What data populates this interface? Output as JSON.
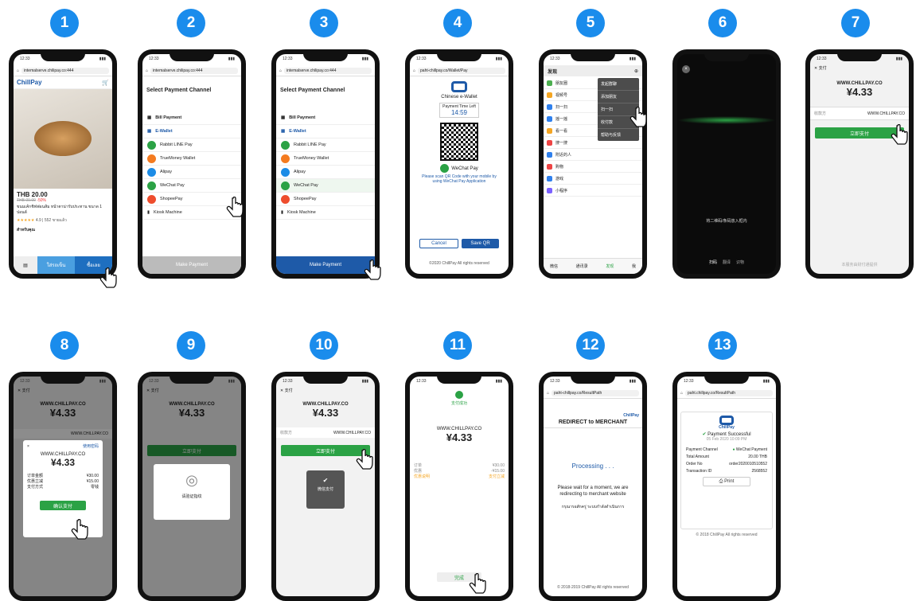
{
  "steps": [
    "1",
    "2",
    "3",
    "4",
    "5",
    "6",
    "7",
    "8",
    "9",
    "10",
    "11",
    "12",
    "13"
  ],
  "colors": {
    "step": "#1a8cec",
    "wechat_green": "#2ba245",
    "chillpay_blue": "#1e5aa8"
  },
  "s1": {
    "url": "intemalserve.chilipay.co:444",
    "logo": "ChillPay",
    "price": "THB 20.00",
    "old_price": "THB 00.00",
    "discount": "-50%",
    "desc": "ขนมเค้กชิฟฟอนส้ม หน้าตาน่ารับประทาน ขนาด 1 ปอนด์",
    "rating": "4.9 | 552 ขายแล้ว",
    "shop": "สำหรับคุณ",
    "cart": "ใส่รถเข็น",
    "buy": "ซื้อเลย"
  },
  "s2": {
    "url": "intemalserve.chilipay.co:444",
    "title": "Select Payment Channel",
    "bill": "Bill Payment",
    "ewallet": "E-Wallet",
    "items": [
      "Rabbit LINE Pay",
      "TrueMoney Wallet",
      "Alipay",
      "WeChat Pay",
      "ShopeePay"
    ],
    "kiosk": "Kiosk Machine",
    "make": "Make Payment"
  },
  "s4": {
    "url": "paht-chillpay.co/Wallet/Pay",
    "brand": "Chinese e-Wallet",
    "timer_label": "Payment Time Left",
    "timer": "14:59",
    "wechat": "WeChat Pay",
    "hint": "Please scan QR Code with your mobile by using WeChat Pay Application",
    "cancel": "Cancel",
    "save": "Save QR",
    "copy": "©2020 ChillPay All rights reserved"
  },
  "s5": {
    "title": "发现",
    "rows": [
      "朋友圈",
      "视频号",
      "扫一扫",
      "摇一摇",
      "看一看",
      "搜一搜",
      "附近的人",
      "购物",
      "游戏",
      "小程序"
    ],
    "menu": [
      "发起群聊",
      "添加朋友",
      "扫一扫",
      "收付款",
      "帮助与反馈"
    ],
    "tabs": [
      "微信",
      "通讯录",
      "发现",
      "我"
    ]
  },
  "s6": {
    "hint": "将二维码/条码放入框内",
    "tabs": [
      "扫码",
      "翻译",
      "识物"
    ]
  },
  "s7": {
    "back": "支付",
    "merchant": "WWW.CHILLPAY.CO",
    "amount": "¥4.33",
    "payee_label": "收款方",
    "payee": "WWW.CHILLPAY.CO",
    "pay": "立即支付",
    "foot": "本服务由财付通提供"
  },
  "s8": {
    "back": "支付",
    "merchant": "WWW.CHILLPAY.CO",
    "amount": "¥4.33",
    "payee": "WWW.CHILLPAY.CO",
    "close": "×",
    "change": "使用密码",
    "d_merchant": "WWW.CHILLPAY.CO",
    "d_amount": "¥4.33",
    "r1_l": "订单金额",
    "r1_v": "¥30.00",
    "r2_l": "优惠立减",
    "r2_v": "¥15.00",
    "r3_l": "支付方式",
    "r3_v": "零钱",
    "confirm": "确认支付"
  },
  "s9": {
    "back": "支付",
    "merchant": "WWW.CHILLPAY.CO",
    "amount": "¥4.33",
    "pay": "立即支付",
    "fp": "请验证指纹"
  },
  "s10": {
    "back": "支付",
    "merchant": "WWW.CHILLPAY.CO",
    "amount": "¥4.33",
    "payee_label": "收款方",
    "payee": "WWW.CHILLPAY.CO",
    "pay": "立即支付",
    "toast": "微信支付"
  },
  "s11": {
    "title": "支付成功",
    "merchant": "WWW.CHILLPAY.CO",
    "amount": "¥4.33",
    "r1_l": "订单",
    "r1_v": "¥30.00",
    "r2_l": "优惠",
    "r2_v": "-¥15.00",
    "r3_l": "优惠说明",
    "r3_v": "支付立减",
    "done": "完成"
  },
  "s12": {
    "url": "paht-chillpay.co/ResultPath",
    "brand": "ChillPay",
    "redirect": "REDIRECT to MERCHANT",
    "processing": "Processing . . .",
    "msg": "Please wait for a moment, we are redirecting to merchant website",
    "thai": "กรุณารอสักครู่ ระบบกำลังดำเนินการ",
    "copy": "© 2018-2019 ChillPay All rights reserved"
  },
  "s13": {
    "url": "paht.chillpay.co/ResultPath",
    "logo": "ChillPay",
    "success": "Payment Successful",
    "date": "05 Feb 2020 10:09 PM",
    "ch_l": "Payment Channel",
    "ch_v": "WeChat Payment",
    "amt_l": "Total Amount",
    "amt_v": "20.00 THB",
    "ord_l": "Order No",
    "ord_v": "order2020010510552",
    "tx_l": "Transaction ID",
    "tx_v": "2568552",
    "print": "Print",
    "copy": "© 2018 ChillPay All rights reserved"
  }
}
